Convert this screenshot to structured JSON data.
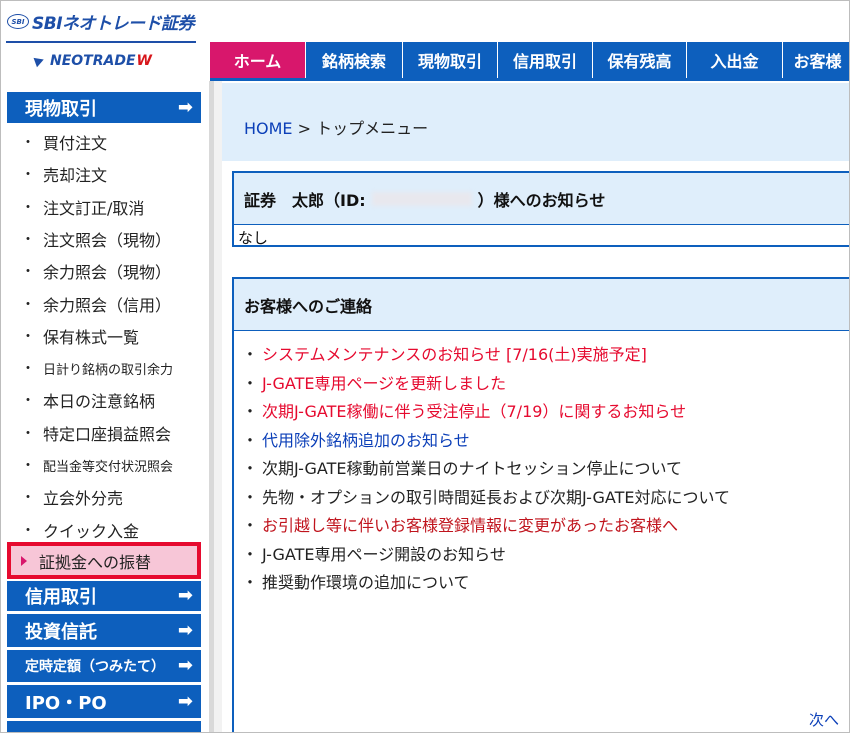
{
  "logo": {
    "sbi_mark": "SBI",
    "sbi_text": "SBIネオトレード証券",
    "neo_text": "NEOTRADE",
    "neo_mark": "W"
  },
  "nav": {
    "tabs": [
      {
        "label": "ホーム",
        "active": true
      },
      {
        "label": "銘柄検索",
        "active": false
      },
      {
        "label": "現物取引",
        "active": false
      },
      {
        "label": "信用取引",
        "active": false
      },
      {
        "label": "保有残高",
        "active": false
      },
      {
        "label": "入出金",
        "active": false
      },
      {
        "label": "お客様",
        "active": false
      }
    ]
  },
  "sidebar": {
    "head1": "現物取引",
    "items": [
      {
        "label": "買付注文",
        "small": false
      },
      {
        "label": "売却注文",
        "small": false
      },
      {
        "label": "注文訂正/取消",
        "small": false
      },
      {
        "label": "注文照会（現物）",
        "small": false
      },
      {
        "label": "余力照会（現物）",
        "small": false
      },
      {
        "label": "余力照会（信用）",
        "small": false
      },
      {
        "label": "保有株式一覧",
        "small": false
      },
      {
        "label": "日計り銘柄の取引余力",
        "small": true
      },
      {
        "label": "本日の注意銘柄",
        "small": false
      },
      {
        "label": "特定口座損益照会",
        "small": false
      },
      {
        "label": "配当金等交付状況照会",
        "small": true
      },
      {
        "label": "立会外分売",
        "small": false
      },
      {
        "label": "クイック入金",
        "small": false
      }
    ],
    "selected": "証拠金への振替",
    "heads": [
      {
        "label": "信用取引"
      },
      {
        "label": "投資信託"
      },
      {
        "label": "定時定額（つみたて）"
      },
      {
        "label": "IPO・PO"
      }
    ],
    "arrow": "➡"
  },
  "breadcrumb": {
    "home": "HOME",
    "rest": " > トップメニュー"
  },
  "notice": {
    "title_prefix": "証券　太郎（ID:",
    "title_suffix": "）様へのお知らせ",
    "body": "なし"
  },
  "contact": {
    "title": "お客様へのご連絡",
    "items": [
      {
        "text": "システムメンテナンスのお知らせ [7/16(土)実施予定]",
        "color": "#e60a2f"
      },
      {
        "text": "J-GATE専用ページを更新しました",
        "color": "#e60a2f"
      },
      {
        "text": "次期J-GATE稼働に伴う受注停止（7/19）に関するお知らせ",
        "color": "#e60a2f"
      },
      {
        "text": "代用除外銘柄追加のお知らせ",
        "color": "#0b3fb8"
      },
      {
        "text": "次期J-GATE稼動前営業日のナイトセッション停止について",
        "color": "#222222"
      },
      {
        "text": "先物・オプションの取引時間延長および次期J-GATE対応について",
        "color": "#222222"
      },
      {
        "text": "お引越し等に伴いお客様登録情報に変更があったお客様へ",
        "color": "#c0141d"
      },
      {
        "text": "J-GATE専用ページ開設のお知らせ",
        "color": "#222222"
      },
      {
        "text": "推奨動作環境の追加について",
        "color": "#222222"
      }
    ]
  },
  "next_link": "次へ"
}
